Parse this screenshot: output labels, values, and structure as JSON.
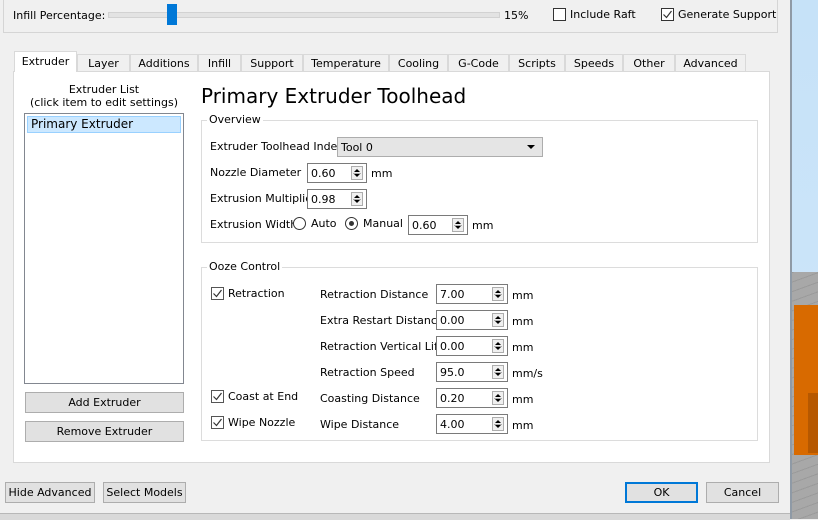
{
  "top": {
    "infill_label": "Infill Percentage:",
    "infill_value_text": "15%",
    "infill_fraction": 0.15,
    "include_raft_label": "Include Raft",
    "include_raft_checked": false,
    "generate_support_label": "Generate Support",
    "generate_support_checked": true
  },
  "tabs": [
    {
      "label": "Extruder",
      "active": true
    },
    {
      "label": "Layer"
    },
    {
      "label": "Additions"
    },
    {
      "label": "Infill"
    },
    {
      "label": "Support"
    },
    {
      "label": "Temperature"
    },
    {
      "label": "Cooling"
    },
    {
      "label": "G-Code"
    },
    {
      "label": "Scripts"
    },
    {
      "label": "Speeds"
    },
    {
      "label": "Other"
    },
    {
      "label": "Advanced"
    }
  ],
  "extruder_list": {
    "title_line1": "Extruder List",
    "title_line2": "(click item to edit settings)",
    "items": [
      "Primary Extruder"
    ],
    "add_button": "Add Extruder",
    "remove_button": "Remove Extruder"
  },
  "panel": {
    "title": "Primary Extruder Toolhead",
    "overview": {
      "title": "Overview",
      "toolhead_index_label": "Extruder Toolhead Index",
      "toolhead_index_value": "Tool 0",
      "nozzle_diameter_label": "Nozzle Diameter",
      "nozzle_diameter_value": "0.60",
      "nozzle_diameter_unit": "mm",
      "extrusion_multiplier_label": "Extrusion Multiplier",
      "extrusion_multiplier_value": "0.98",
      "extrusion_width_label": "Extrusion Width",
      "auto_label": "Auto",
      "manual_label": "Manual",
      "extrusion_width_mode": "Manual",
      "extrusion_width_value": "0.60",
      "extrusion_width_unit": "mm"
    },
    "ooze": {
      "title": "Ooze Control",
      "retraction_label": "Retraction",
      "retraction_checked": true,
      "coast_label": "Coast at End",
      "coast_checked": true,
      "wipe_label": "Wipe Nozzle",
      "wipe_checked": true,
      "fields": [
        {
          "label": "Retraction Distance",
          "value": "7.00",
          "unit": "mm"
        },
        {
          "label": "Extra Restart Distance",
          "value": "0.00",
          "unit": "mm"
        },
        {
          "label": "Retraction Vertical Lift",
          "value": "0.00",
          "unit": "mm"
        },
        {
          "label": "Retraction Speed",
          "value": "95.0",
          "unit": "mm/s"
        },
        {
          "label": "Coasting Distance",
          "value": "0.20",
          "unit": "mm"
        },
        {
          "label": "Wipe Distance",
          "value": "4.00",
          "unit": "mm"
        }
      ]
    }
  },
  "footer": {
    "hide_advanced": "Hide Advanced",
    "select_models": "Select Models",
    "ok": "OK",
    "cancel": "Cancel"
  }
}
